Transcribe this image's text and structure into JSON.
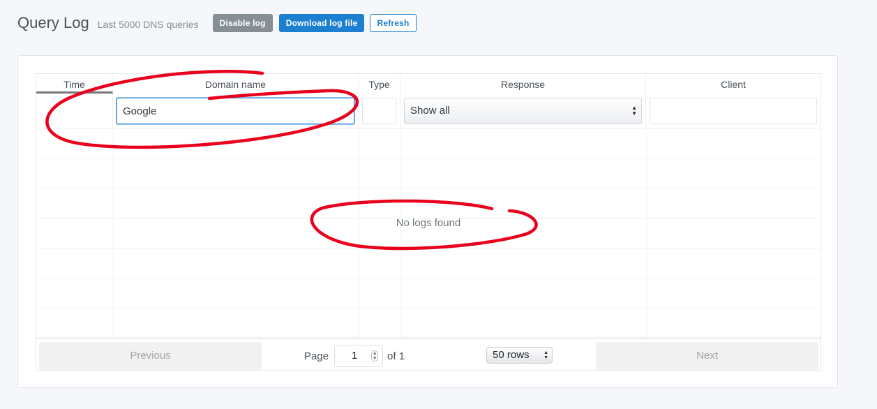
{
  "header": {
    "title": "Query Log",
    "subtitle": "Last 5000 DNS queries",
    "buttons": {
      "disable": "Disable log",
      "download": "Download log file",
      "refresh": "Refresh"
    }
  },
  "table": {
    "columns": [
      "Time",
      "Domain name",
      "Type",
      "Response",
      "Client"
    ],
    "filters": {
      "domain_value": "Google",
      "type_value": "",
      "response_selected": "Show all",
      "client_value": ""
    },
    "empty_text": "No logs found"
  },
  "pagination": {
    "previous": "Previous",
    "next": "Next",
    "page_label": "Page",
    "page_value": "1",
    "of_label": "of 1",
    "rows_selected": "50 rows"
  },
  "colors": {
    "primary": "#1d7fcf",
    "secondary": "#868e96",
    "annotation": "#e8001c"
  }
}
